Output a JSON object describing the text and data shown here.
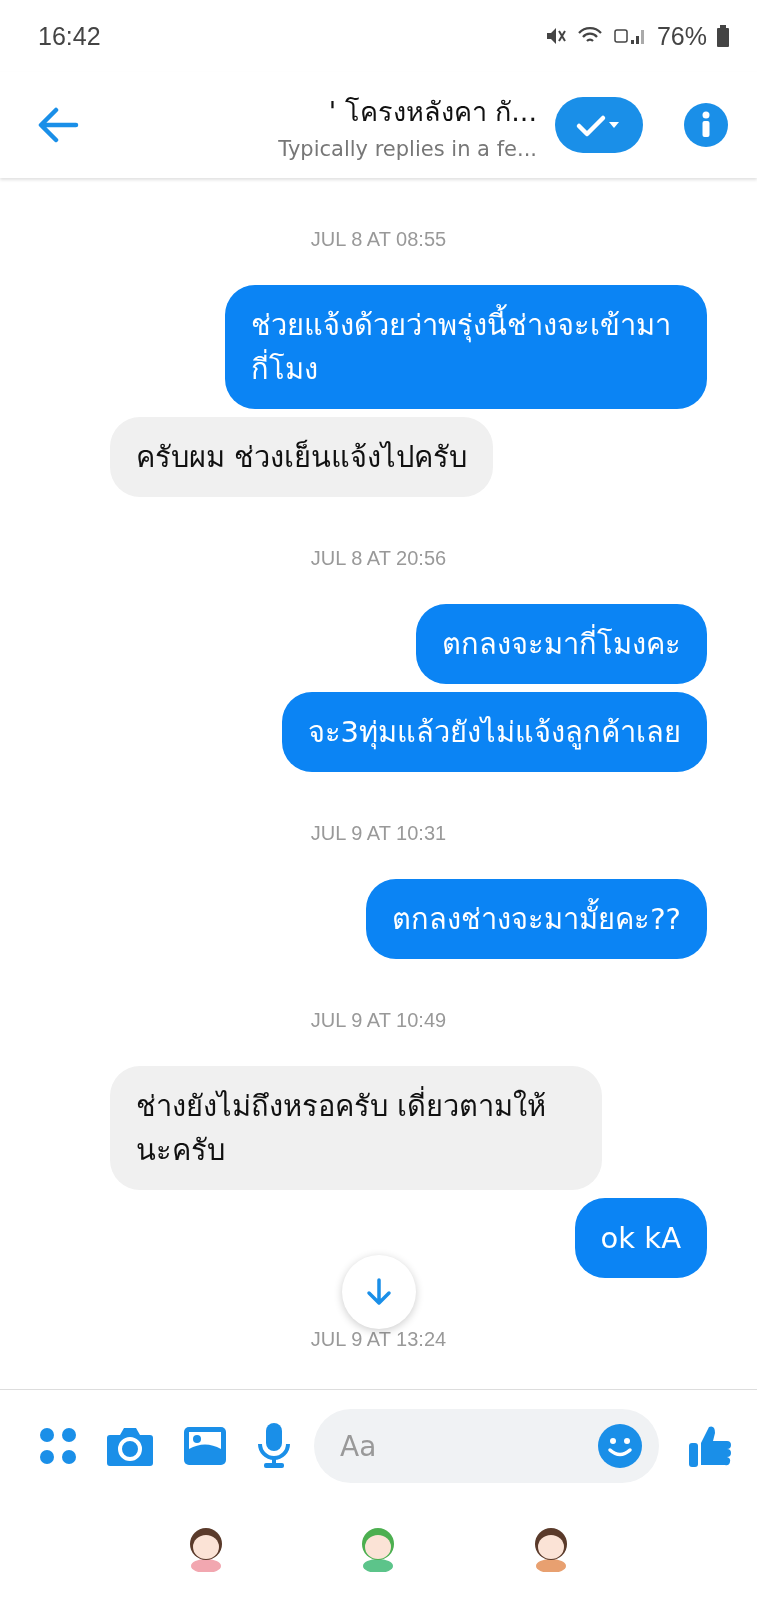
{
  "status_bar": {
    "time": "16:42",
    "battery": "76%"
  },
  "header": {
    "title": "' โครงหลังคา กั...",
    "subtitle": "Typically replies in a fe..."
  },
  "messages": [
    {
      "kind": "timestamp",
      "text": "JUL 8 AT 08:55"
    },
    {
      "kind": "sent",
      "text": "ช่วยแจ้งด้วยว่าพรุ่งนี้ช่างจะเข้ามากี่โมง"
    },
    {
      "kind": "received",
      "text": "ครับผม ช่วงเย็นแจ้งไปครับ"
    },
    {
      "kind": "timestamp",
      "text": "JUL 8 AT 20:56"
    },
    {
      "kind": "sent",
      "text": "ตกลงจะมากี่โมงคะ"
    },
    {
      "kind": "sent",
      "text": "จะ3ทุ่มแล้วยังไม่แจ้งลูกค้าเลย"
    },
    {
      "kind": "timestamp",
      "text": "JUL 9 AT 10:31"
    },
    {
      "kind": "sent",
      "text": "ตกลงช่างจะมามั้ยคะ??"
    },
    {
      "kind": "timestamp",
      "text": "JUL 9 AT 10:49"
    },
    {
      "kind": "received",
      "text": "ช่างยังไม่ถึงหรอครับ  เดี่ยวตามให้นะครับ"
    },
    {
      "kind": "sent",
      "text": "ok kA"
    },
    {
      "kind": "timestamp",
      "text": "JUL 9 AT 13:24"
    }
  ],
  "composer": {
    "placeholder": "Aa"
  }
}
